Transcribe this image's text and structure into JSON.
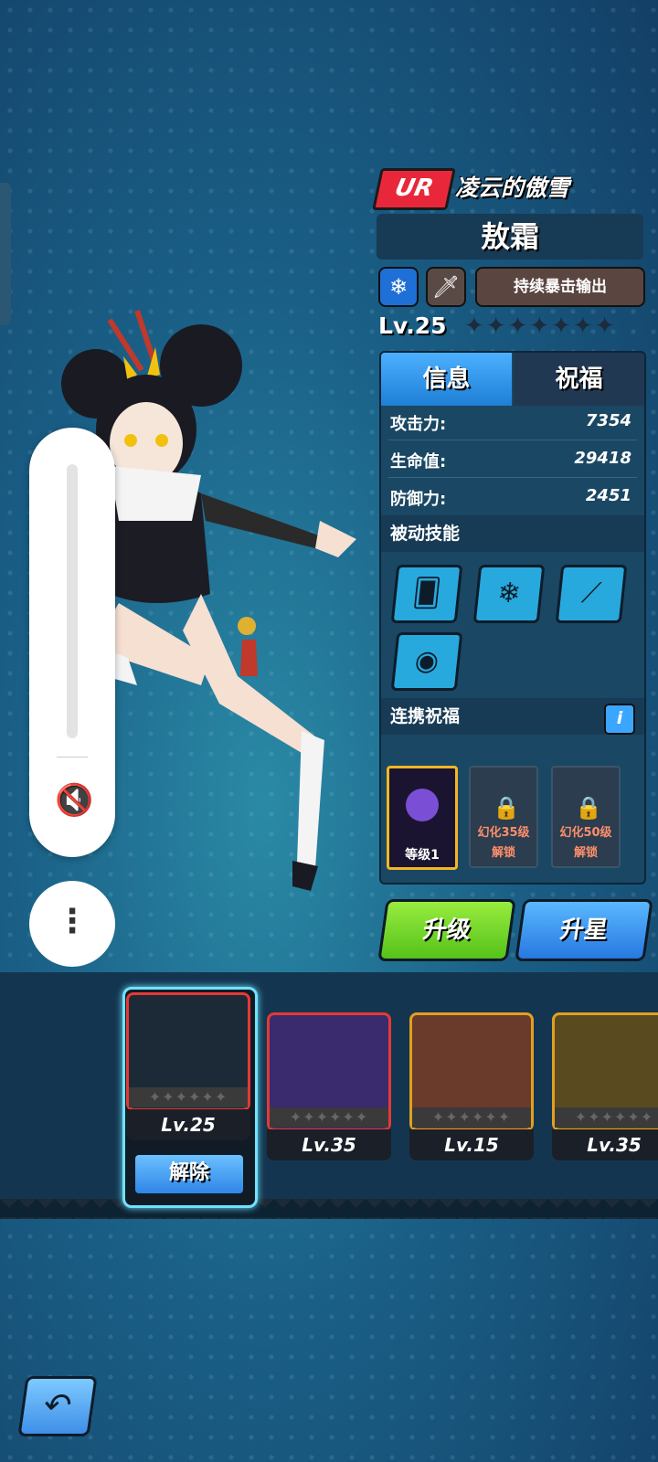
{
  "header": {
    "rarity": "UR",
    "subtitle": "凌云的傲雪",
    "name": "敖霜",
    "tag": "持续暴击输出",
    "level": "Lv.25",
    "stars": "✦✦✦✦✦✦✦",
    "icons": [
      "snowflake-icon",
      "sword-icon"
    ]
  },
  "panel": {
    "tabs": [
      "信息",
      "祝福"
    ],
    "stats": [
      {
        "label": "攻击力:",
        "value": "7354"
      },
      {
        "label": "生命值:",
        "value": "29418"
      },
      {
        "label": "防御力:",
        "value": "2451"
      }
    ],
    "passive_title": "被动技能",
    "skills": [
      "cards-dice-icon",
      "snowflakes-icon",
      "claw-slash-icon",
      "dragon-emblem-icon"
    ],
    "bless_title": "连携祝福",
    "info_label": "i",
    "slots": [
      {
        "name": "owned",
        "level": "等级1"
      },
      {
        "line1": "幻化35级",
        "line2": "解锁"
      },
      {
        "line1": "幻化50级",
        "line2": "解锁"
      }
    ]
  },
  "buttons": {
    "upgrade": "升级",
    "star_up": "升星",
    "unequip": "解除"
  },
  "roster": {
    "cards": [
      {
        "level": "Lv.25",
        "border": "#e53935",
        "art": "#1b2a36",
        "stars": "✦✦✦✦✦✦"
      },
      {
        "level": "Lv.35",
        "border": "#e53935",
        "art": "#3a2a6e",
        "stars": "✦✦✦✦✦✦"
      },
      {
        "level": "Lv.15",
        "border": "#e0a020",
        "art": "#6a3a2a",
        "stars": "✦✦✦✦✦✦"
      },
      {
        "level": "Lv.35",
        "border": "#e0a020",
        "art": "#5a4a20",
        "stars": "✦✦✦✦✦✦"
      }
    ]
  },
  "colors": {
    "accent": "#3aa6ff",
    "ur": "#e8283a",
    "green": "#6cd82a"
  }
}
